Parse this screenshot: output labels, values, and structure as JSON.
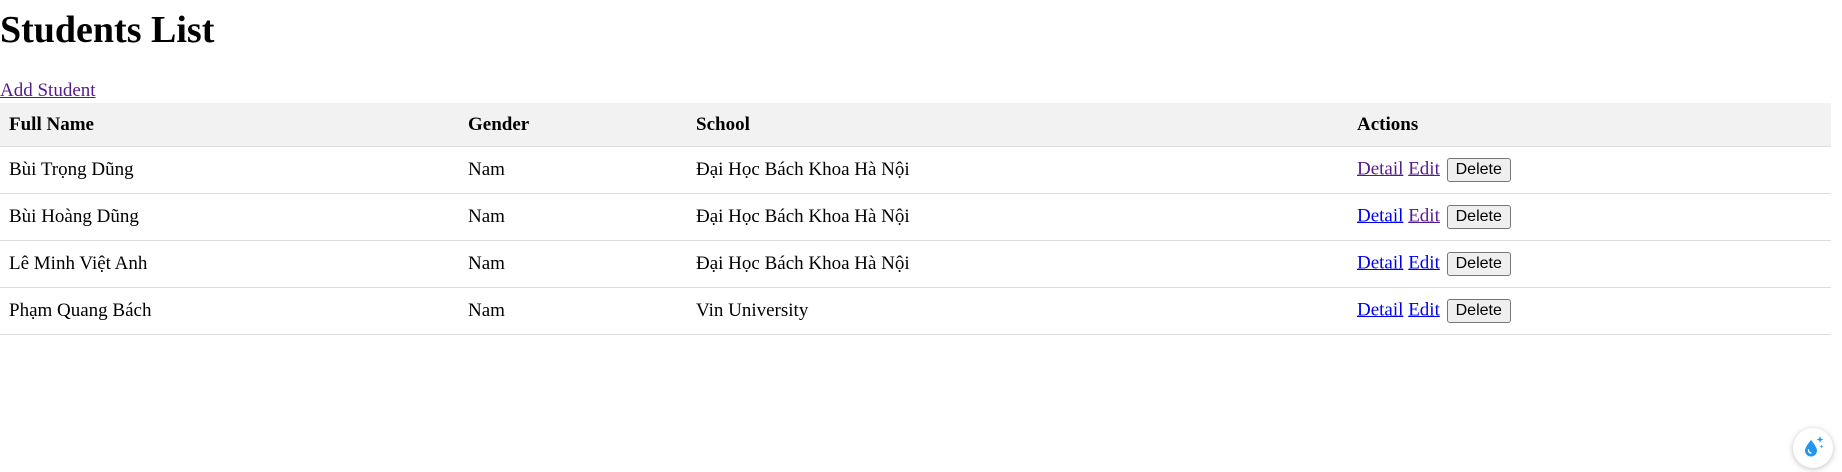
{
  "page": {
    "title": "Students List",
    "add_link": "Add Student"
  },
  "table": {
    "headers": {
      "full_name": "Full Name",
      "gender": "Gender",
      "school": "School",
      "actions": "Actions"
    },
    "rows": [
      {
        "full_name": "Bùi Trọng Dũng",
        "gender": "Nam",
        "school": "Đại Học Bách Khoa Hà Nội"
      },
      {
        "full_name": "Bùi Hoàng Dũng",
        "gender": "Nam",
        "school": "Đại Học Bách Khoa Hà Nội"
      },
      {
        "full_name": "Lê Minh Việt Anh",
        "gender": "Nam",
        "school": "Đại Học Bách Khoa Hà Nội"
      },
      {
        "full_name": "Phạm Quang Bách",
        "gender": "Nam",
        "school": "Vin University"
      }
    ],
    "actions": {
      "detail_label": "Detail",
      "edit_label": "Edit",
      "delete_label": "Delete"
    }
  },
  "colors": {
    "link": "#0000ee",
    "visited_link": "#551a8b",
    "header_bg": "#f2f2f2",
    "widget_accent": "#2196f3"
  },
  "icons": {
    "floating_widget": "water-drop-sparkle-icon"
  }
}
